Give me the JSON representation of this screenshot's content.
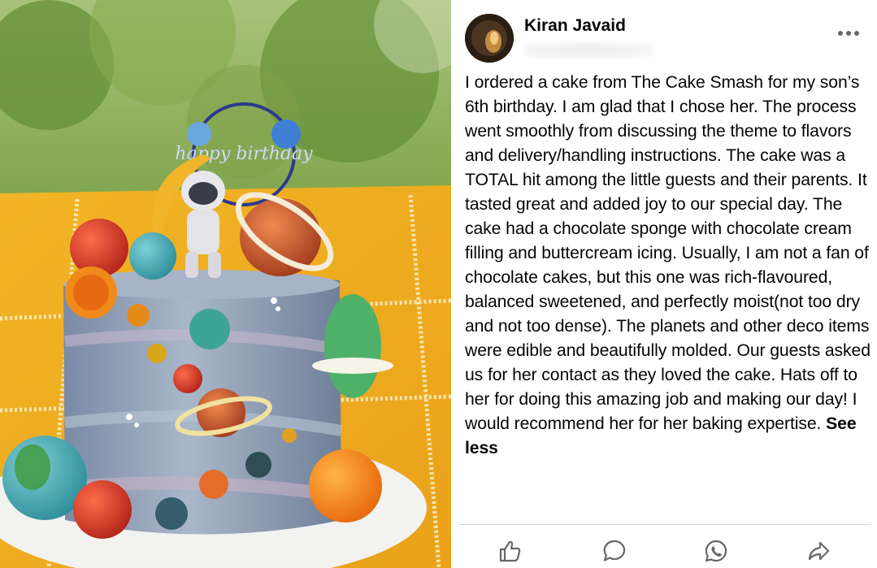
{
  "post": {
    "author": "Kiran Javaid",
    "text": "I ordered a cake from The Cake Smash for my son’s 6th birthday. I am glad that I chose her. The process went smoothly from discussing the theme to flavors and delivery/handling instructions. The cake was a TOTAL hit among the little guests and their parents. It tasted great and added joy to our special day. The cake had a chocolate sponge with chocolate cream filling and buttercream icing. Usually, I am not a fan of chocolate cakes, but this one was rich-flavoured, balanced sweetened, and perfectly moist(not too dry and not too dense). The planets and other deco items were edible and beautifully molded. Our guests asked us for her contact as they loved the cake. Hats off to her for doing this amazing job and making our day! I would recommend her for her baking expertise.",
    "see_less": "See less",
    "cake_topper_text": "happy birthday"
  },
  "icons": {
    "more": "more-options-icon",
    "like": "like-icon",
    "comment": "comment-icon",
    "whatsapp": "whatsapp-icon",
    "share": "share-icon"
  },
  "colors": {
    "text": "#050505",
    "icon": "#65676b",
    "divider": "#ced0d4"
  }
}
